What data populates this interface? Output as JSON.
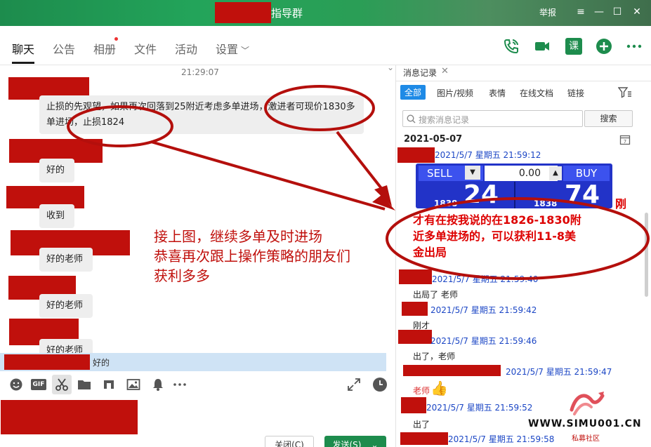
{
  "window": {
    "title": "指导群",
    "report_label": "举报"
  },
  "tabs": [
    {
      "label": "聊天"
    },
    {
      "label": "公告"
    },
    {
      "label": "相册"
    },
    {
      "label": "文件"
    },
    {
      "label": "活动"
    },
    {
      "label": "设置"
    }
  ],
  "chat": {
    "timestamp": "21:29:07",
    "messages": [
      {
        "text": "止损的先观望，如果再次回落到25附近考虑多单进场，激进者可现价1830多单进场，止损1824"
      },
      {
        "text": "好的"
      },
      {
        "text": "收到"
      },
      {
        "text": "好的老师"
      },
      {
        "text": "好的老师"
      },
      {
        "text": "好的老师"
      }
    ],
    "overlay_lines": [
      "接上图，继续多单及时进场",
      "恭喜再次跟上操作策略的朋友们",
      "获利多多"
    ]
  },
  "quote": {
    "text": "好的"
  },
  "input": {
    "close_label": "关闭(C)",
    "send_label": "发送(S)"
  },
  "history": {
    "title": "消息记录",
    "filters": [
      {
        "label": "全部"
      },
      {
        "label": "图片/视频"
      },
      {
        "label": "表情"
      },
      {
        "label": "在线文档"
      },
      {
        "label": "链接"
      }
    ],
    "search_placeholder": "搜索消息记录",
    "search_button": "搜索",
    "date": "2021-05-07",
    "entries": [
      {
        "meta": "2021/5/7 星期五 21:59:12",
        "text": ""
      },
      {
        "meta": "2021/5/7 星期五 21:59:40",
        "text": "出局了  老师"
      },
      {
        "meta": "2021/5/7 星期五 21:59:42",
        "text": "刚才"
      },
      {
        "meta": "2021/5/7 星期五 21:59:46",
        "text": "出了，老师"
      },
      {
        "meta": "2021/5/7 星期五 21:59:47",
        "text": "老师"
      },
      {
        "meta": "2021/5/7 星期五 21:59:52",
        "text": "出了"
      },
      {
        "meta": "2021/5/7 星期五 21:59:58",
        "text": ""
      }
    ],
    "trade": {
      "sell_label": "SELL",
      "buy_label": "BUY",
      "amount": "0.00",
      "sell_big": "24",
      "sell_small": "1838",
      "buy_big": "74",
      "buy_small": "1838"
    },
    "annotation_lines": [
      "刚",
      "才有在按我说的在1826-1830附",
      "近多单进场的，可以获利11-8美",
      "金出局"
    ]
  },
  "watermark": {
    "text": "WWW.SIMU001.CN",
    "sub": "私募社区"
  },
  "colors": {
    "title_green": "#1d8c4d",
    "redact": "#c0100c",
    "accent_blue": "#1e8ae6",
    "annotation_red": "#d00"
  }
}
